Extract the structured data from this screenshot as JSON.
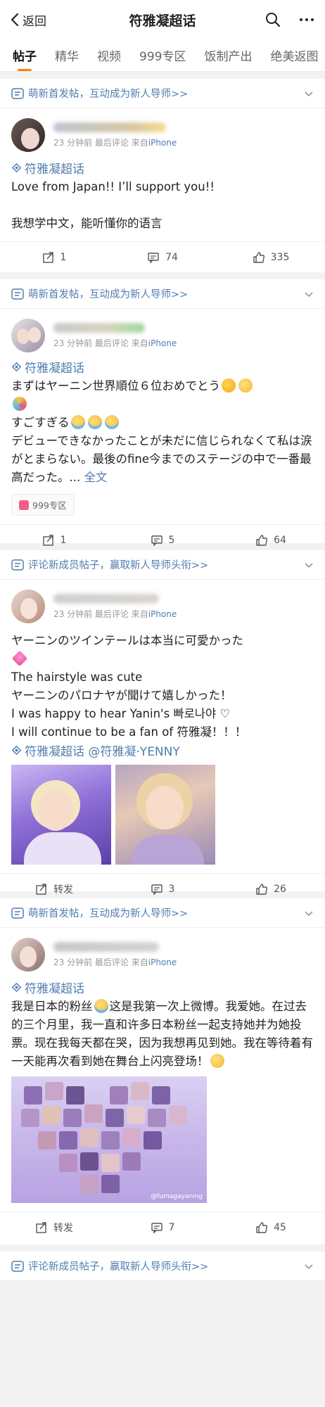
{
  "header": {
    "back_label": "返回",
    "title": "符雅凝超话"
  },
  "tabs": [
    "帖子",
    "精华",
    "视频",
    "999专区",
    "饭制产出",
    "绝美返图"
  ],
  "posts": [
    {
      "banner": "萌新首发帖，互动成为新人导师>>",
      "meta_time": "23 分钟前 最后评论",
      "meta_source_prefix": "来自",
      "meta_source": "iPhone",
      "topic": "符雅凝超话",
      "text_lines": [
        "Love from Japan!! I’ll support you!!",
        "",
        "我想学中文，能听懂你的语言"
      ],
      "repost": "1",
      "comments": "74",
      "likes": "335"
    },
    {
      "banner": "萌新首发帖，互动成为新人导师>>",
      "meta_time": "23 分钟前 最后评论",
      "meta_source_prefix": "来自",
      "meta_source": "iPhone",
      "topic": "符雅凝超话",
      "line1": "まずはヤーニン世界順位６位おめでとう",
      "line2": "すごすぎる",
      "line3": "デビューできなかったことが未だに信じられなくて私は涙がとまらない。最後のfine今までのステージの中で一番最高だった。...",
      "more": "全文",
      "zone_tag": "999专区",
      "repost": "1",
      "comments": "5",
      "likes": "64"
    },
    {
      "banner": "评论新成员帖子，赢取新人导师头衔>>",
      "meta_time": "23 分钟前 最后评论",
      "meta_source_prefix": "来自",
      "meta_source": "iPhone",
      "line1": "ヤーニンのツインテールは本当に可愛かった",
      "line2": "The hairstyle was cute",
      "line3": "ヤーニンのパロナヤが聞けて嬉しかった！",
      "line4": "I was happy to hear Yanin's 빠로나야 ♡",
      "line5": "I will continue to be a fan of 符雅凝！！！",
      "topic": "符雅凝超话 @符雅凝·YENNY",
      "repost": "转发",
      "comments": "3",
      "likes": "26"
    },
    {
      "banner": "萌新首发帖，互动成为新人导师>>",
      "meta_time": "23 分钟前 最后评论",
      "meta_source_prefix": "来自",
      "meta_source": "iPhone",
      "topic": "符雅凝超话",
      "text_a": "我是日本的粉丝",
      "text_b": "这是我第一次上微博。我爱她。在过去的三个月里，我一直和许多日本粉丝一起支持她并为她投票。现在我每天都在哭，因为我想再见到她。我在等待着有一天能再次看到她在舞台上闪亮登场！",
      "watermark": "@fumagayaning",
      "repost": "转发",
      "comments": "7",
      "likes": "45"
    }
  ],
  "footer_banner": "评论新成员帖子，赢取新人导师头衔>>",
  "colors": {
    "link": "#507daf",
    "accent": "#ff8200",
    "bg": "#f2f2f2"
  }
}
